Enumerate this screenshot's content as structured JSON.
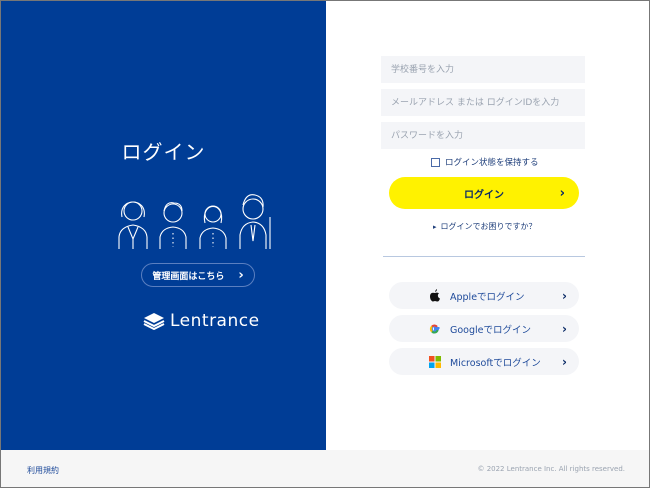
{
  "left": {
    "title": "ログイン",
    "admin_link": "管理画面はこちら",
    "admin_chevron": "›",
    "brand": "Lentrance",
    "colors": {
      "panel": "#003d96"
    }
  },
  "form": {
    "school_placeholder": "学校番号を入力",
    "id_placeholder": "メールアドレス または ログインIDを入力",
    "password_placeholder": "パスワードを入力",
    "keep_login": "ログイン状態を保持する",
    "login_button": "ログイン",
    "chevron": "›",
    "help_link": "ログインでお困りですか？",
    "help_arrow": "▸",
    "colors": {
      "login_button": "#fff200"
    }
  },
  "sso": [
    {
      "label": "Appleでログイン",
      "icon": "apple-icon"
    },
    {
      "label": "Googleでログイン",
      "icon": "google-icon"
    },
    {
      "label": "Microsoftでログイン",
      "icon": "microsoft-icon"
    }
  ],
  "footer": {
    "terms": "利用規約",
    "copyright": "© 2022 Lentrance Inc. All rights reserved."
  }
}
